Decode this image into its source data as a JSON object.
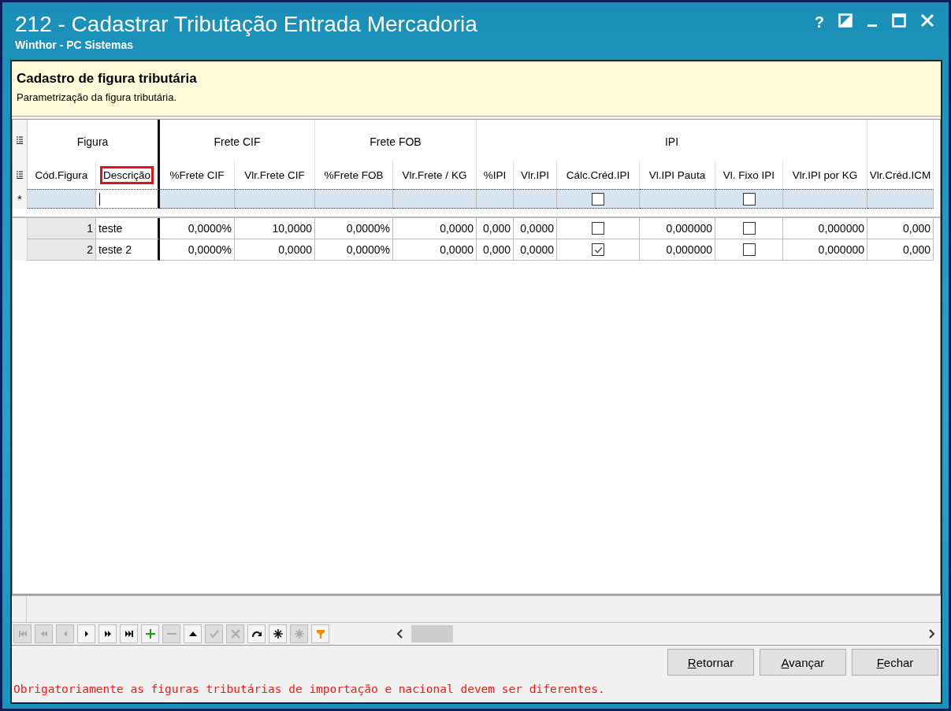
{
  "window": {
    "title": "212 - Cadastrar Tributação Entrada Mercadoria",
    "subtitle": "Winthor - PC Sistemas",
    "help": "?"
  },
  "header": {
    "title": "Cadastro de figura tributária",
    "description": "Parametrização da figura tributária."
  },
  "grid": {
    "column_groups": [
      {
        "label": "Figura",
        "columns": [
          {
            "label": "Cód.Figura",
            "kind": "number",
            "highlighted": false,
            "editing": false
          },
          {
            "label": "Descrição",
            "kind": "text",
            "highlighted": true,
            "editing": true
          }
        ]
      },
      {
        "label": "Frete CIF",
        "columns": [
          {
            "label": "%Frete CIF",
            "kind": "number",
            "highlighted": false,
            "editing": false
          },
          {
            "label": "Vlr.Frete CIF",
            "kind": "number",
            "highlighted": false,
            "editing": false
          }
        ]
      },
      {
        "label": "Frete FOB",
        "columns": [
          {
            "label": "%Frete FOB",
            "kind": "number",
            "highlighted": false,
            "editing": false
          },
          {
            "label": "Vlr.Frete / KG",
            "kind": "number",
            "highlighted": false,
            "editing": false
          }
        ]
      },
      {
        "label": "IPI",
        "columns": [
          {
            "label": "%IPI",
            "kind": "number",
            "highlighted": false,
            "editing": false
          },
          {
            "label": "Vlr.IPI",
            "kind": "number",
            "highlighted": false,
            "editing": false
          },
          {
            "label": "Cálc.Créd.IPI",
            "kind": "checkbox",
            "highlighted": false,
            "editing": false
          },
          {
            "label": "Vl.IPI Pauta",
            "kind": "number",
            "highlighted": false,
            "editing": false
          },
          {
            "label": "Vl. Fixo IPI",
            "kind": "checkbox",
            "highlighted": false,
            "editing": false
          },
          {
            "label": "Vlr.IPI por KG",
            "kind": "number",
            "highlighted": false,
            "editing": false
          }
        ]
      },
      {
        "columns": [
          {
            "label": "Vlr.Créd.ICM",
            "kind": "number",
            "highlighted": false,
            "editing": false
          }
        ]
      }
    ],
    "new_row": {
      "indicator": "*",
      "checks": [
        false,
        false
      ]
    },
    "rows": [
      {
        "cells": [
          "1",
          "teste",
          "0,0000%",
          "10,0000",
          "0,0000%",
          "0,0000",
          "0,000",
          "0,0000",
          false,
          "0,000000",
          false,
          "0,000000",
          "0,000"
        ]
      },
      {
        "cells": [
          "2",
          "teste 2",
          "0,0000%",
          "0,0000",
          "0,0000%",
          "0,0000",
          "0,000",
          "0,0000",
          true,
          "0,000000",
          false,
          "0,000000",
          "0,000"
        ]
      }
    ]
  },
  "navigator": [
    {
      "kind": "first",
      "disabled": true
    },
    {
      "kind": "prior-page",
      "disabled": true
    },
    {
      "kind": "prior",
      "disabled": true
    },
    {
      "kind": "next",
      "disabled": false
    },
    {
      "kind": "next-page",
      "disabled": false
    },
    {
      "kind": "last",
      "disabled": false
    },
    {
      "kind": "insert",
      "disabled": false
    },
    {
      "kind": "delete",
      "disabled": true
    },
    {
      "kind": "edit",
      "disabled": false
    },
    {
      "kind": "post",
      "disabled": true
    },
    {
      "kind": "cancel",
      "disabled": true
    },
    {
      "kind": "refresh",
      "disabled": false
    },
    {
      "kind": "bookmark",
      "disabled": false
    },
    {
      "kind": "goto-bookmark",
      "disabled": true
    },
    {
      "kind": "filter",
      "disabled": false
    }
  ],
  "buttons": [
    {
      "label": "Retornar",
      "access_key_underlined": true
    },
    {
      "label": "Avançar",
      "access_key_underlined": true
    },
    {
      "label": "Fechar",
      "access_key_underlined": true
    }
  ],
  "status_message": "Obrigatoriamente as figuras tributárias de importação e nacional devem ser diferentes."
}
